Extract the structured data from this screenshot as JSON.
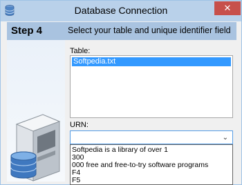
{
  "window": {
    "title": "Database Connection",
    "close_glyph": "✕",
    "app_icon": "database-icon"
  },
  "header": {
    "step": "Step 4",
    "description": "Select your table and unique identifier field"
  },
  "table_section": {
    "label": "Table:",
    "items": [
      "Softpedia.txt"
    ],
    "selected_index": 0
  },
  "urn_section": {
    "label": "URN:",
    "selected_value": "",
    "arrow_glyph": "⌄",
    "options": [
      "Softpedia is a library of over 1",
      "300",
      "000 free and free-to-try software programs",
      "F4",
      "F5"
    ]
  },
  "colors": {
    "title_bar": "#b9d1ea",
    "header_band": "#a9c3e0",
    "selection": "#3399ff",
    "close_button": "#c7504b"
  }
}
